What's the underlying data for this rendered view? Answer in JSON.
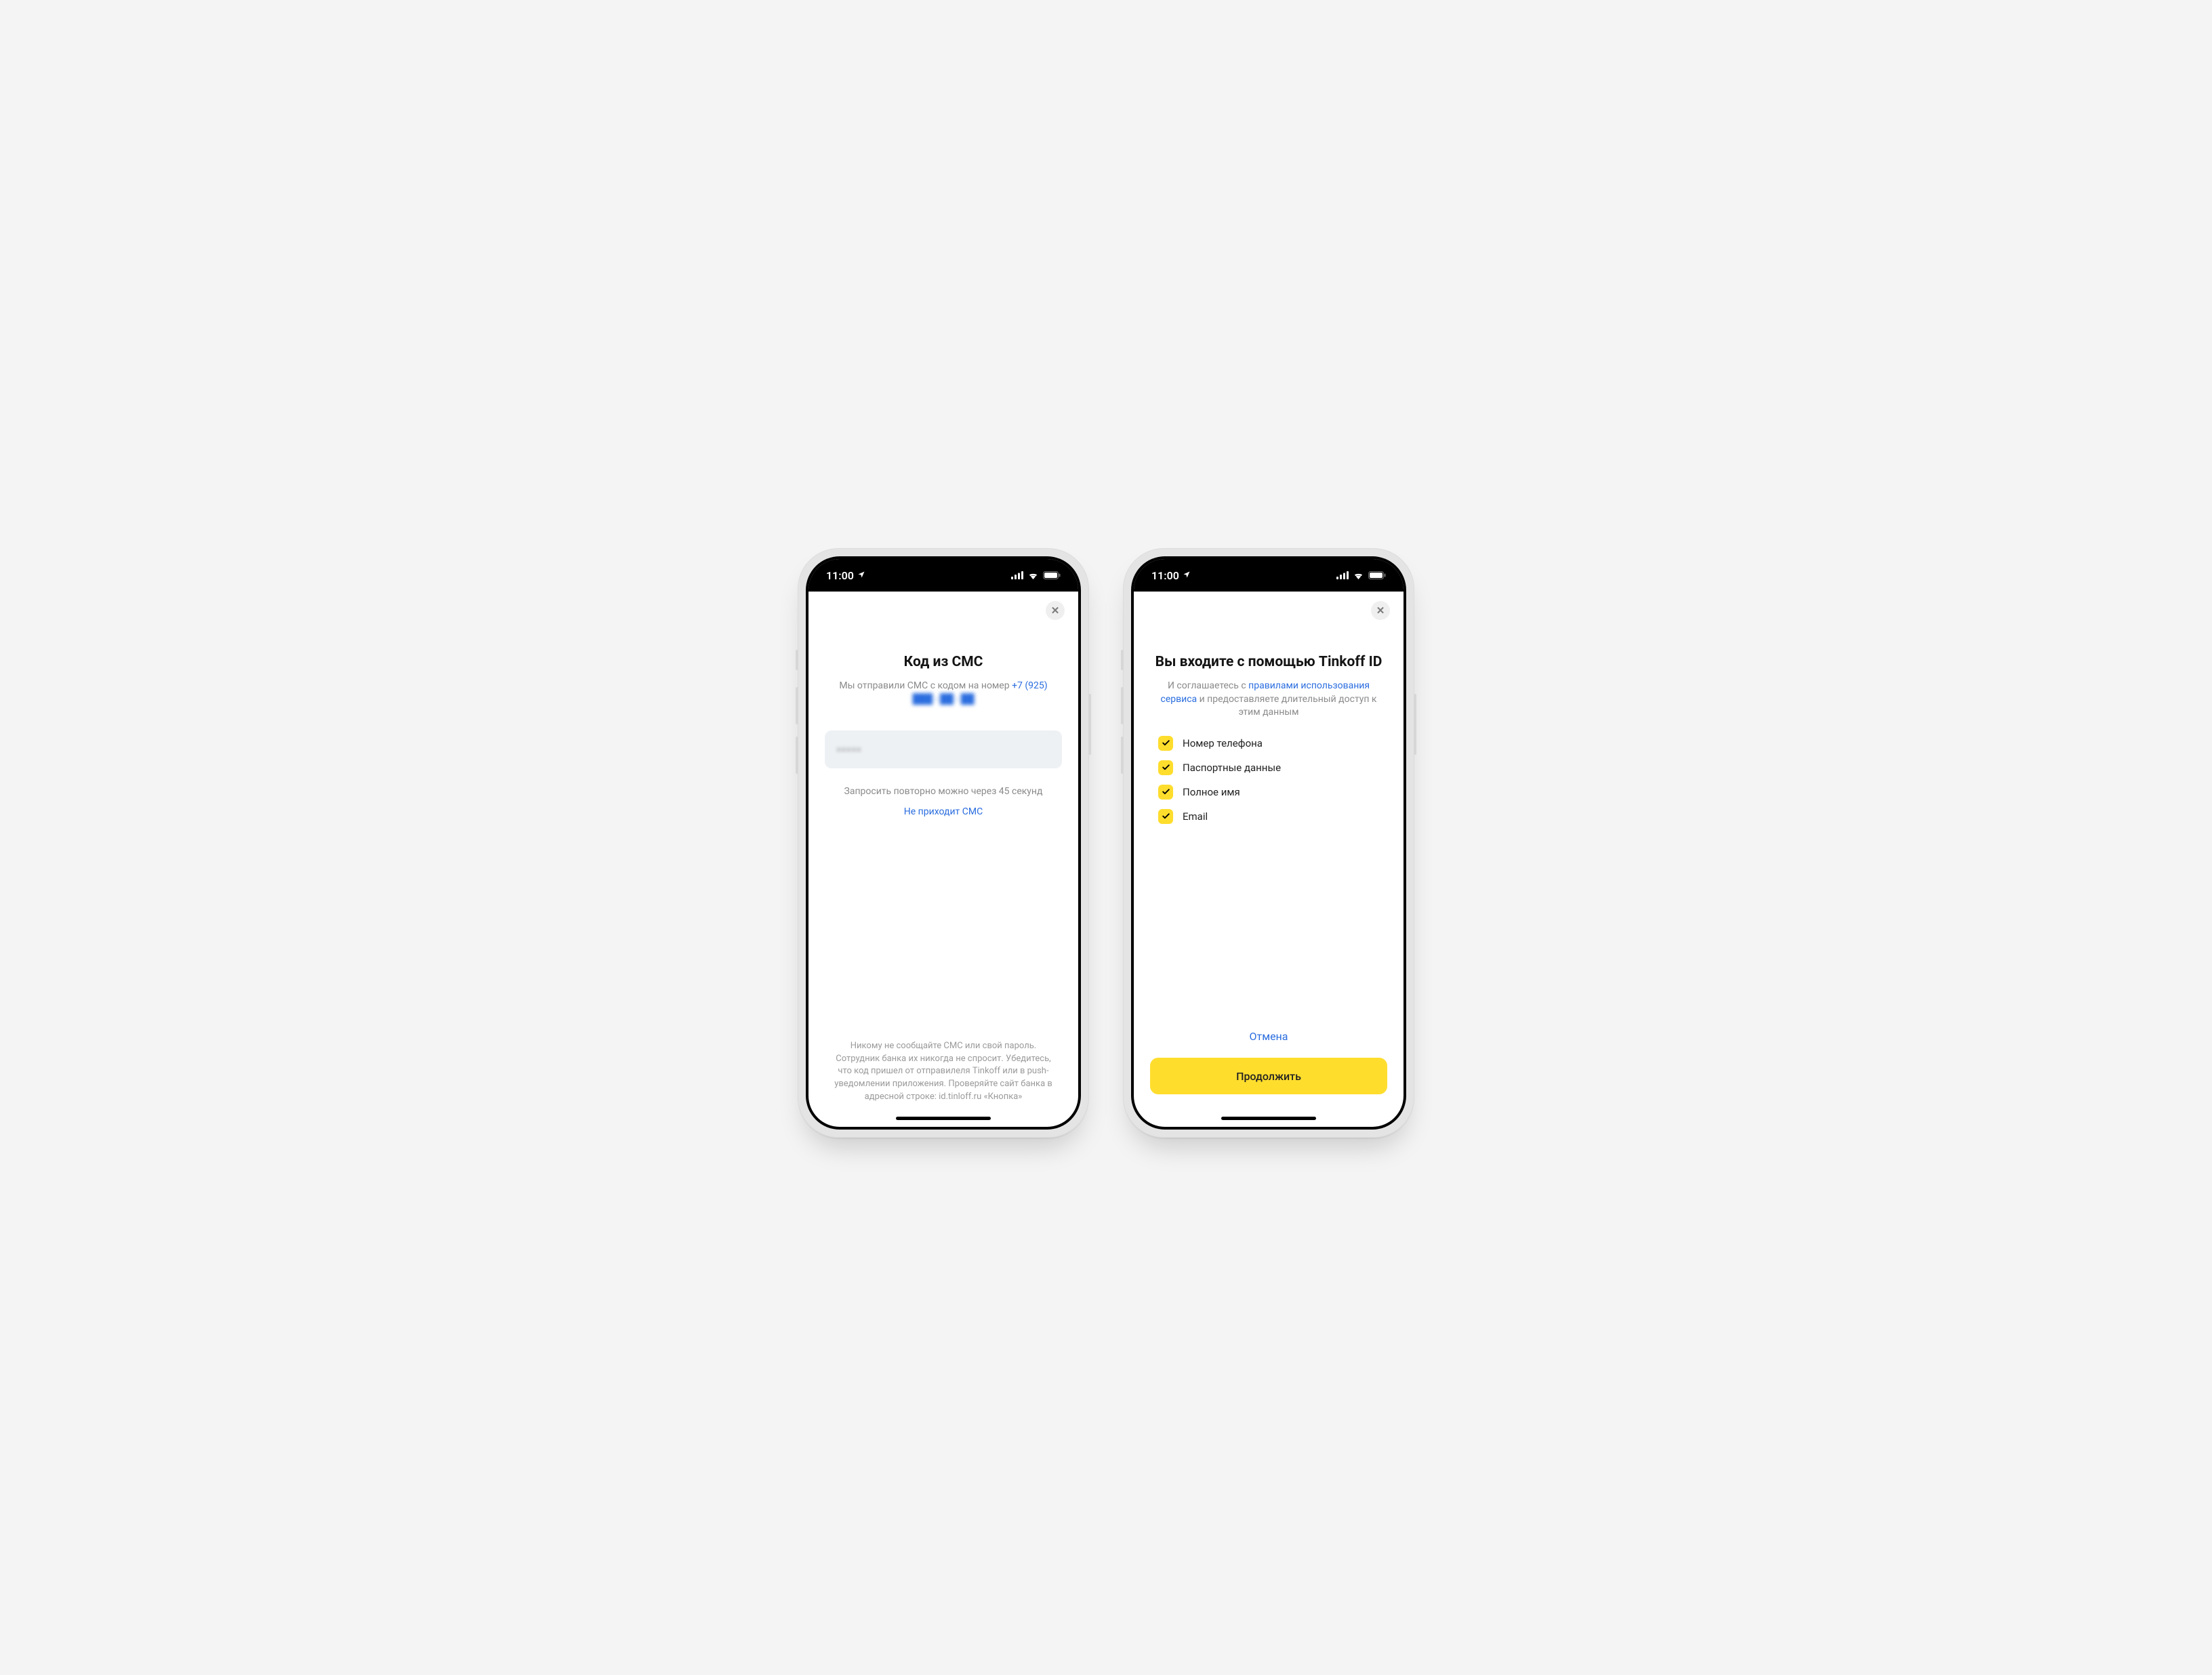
{
  "statusbar": {
    "time": "11:00"
  },
  "left": {
    "close": "✕",
    "title": "Код из СМС",
    "subtitle_prefix": "Мы отправили СМС с кодом на номер ",
    "phone_prefix": "+7 (925)",
    "phone_masked": "███ - ██ - ██",
    "code_value": "•••••",
    "resend": "Запросить повторно можно через 45 секунд",
    "no_sms": "Не приходит СМС",
    "warning": "Никому не сообщайте СМС или свой пароль. Сотрудник банка их никогда не спросит. Убедитесь, что код пришел от отправилеля Tinkoff или в push- уведомлении приложения. Проверяйте сайт банка в адресной строке: id.tinloff.ru «Кнопка»"
  },
  "right": {
    "close": "✕",
    "title": "Вы входите с помощью Tinkoff ID",
    "sub_pre": "И соглашаетесь с ",
    "sub_link": "правилами использования сервиса",
    "sub_post": " и предоставляете длительный доступ к этим данным",
    "permissions": [
      "Номер телефона",
      "Паспортные данные",
      "Полное имя",
      "Email"
    ],
    "cancel": "Отмена",
    "continue": "Продолжить"
  }
}
